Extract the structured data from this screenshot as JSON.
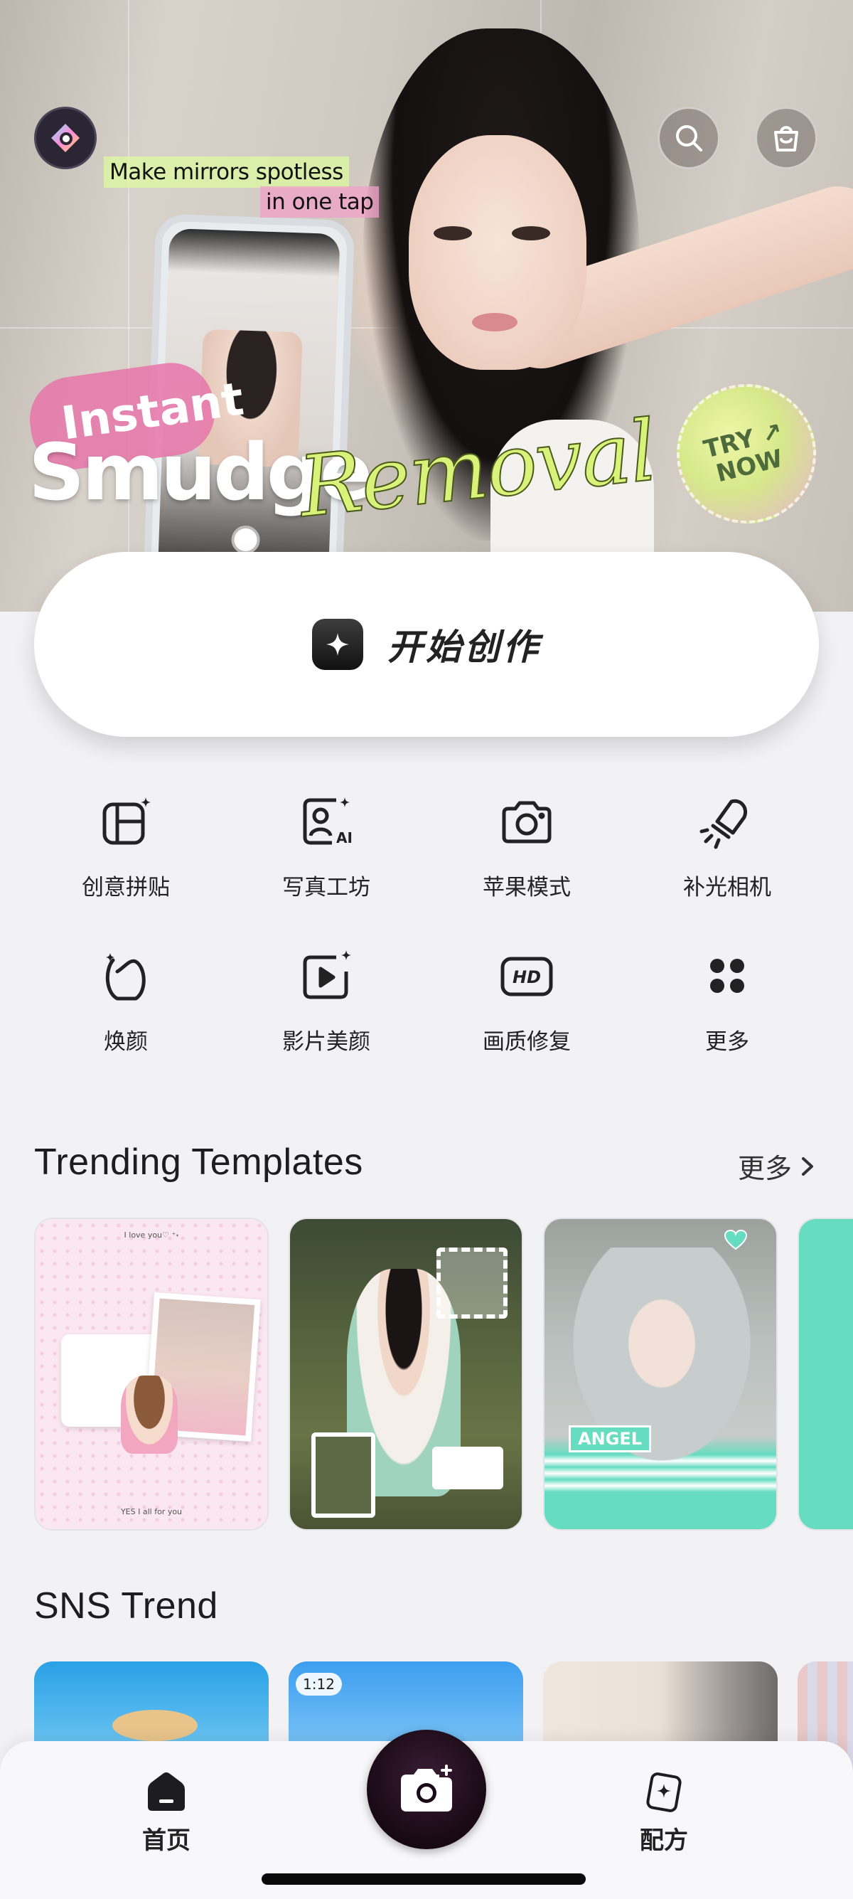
{
  "hero": {
    "promo_line1": "Make mirrors spotless",
    "promo_line2": "in one tap",
    "headline_instant": "Instant",
    "headline_smudge": "Smudge",
    "headline_removal": "Removal",
    "cta_badge_line1": "TRY ↗",
    "cta_badge_line2": "NOW"
  },
  "header": {
    "logo_icon": "app-logo-icon",
    "search_icon": "search-icon",
    "bag_icon": "shopping-bag-icon"
  },
  "cta": {
    "label": "开始创作",
    "icon": "sparkle-icon"
  },
  "features": [
    {
      "label": "创意拼贴",
      "icon": "collage-icon"
    },
    {
      "label": "写真工坊",
      "icon": "ai-portrait-icon"
    },
    {
      "label": "苹果模式",
      "icon": "camera-icon"
    },
    {
      "label": "补光相机",
      "icon": "fill-light-icon"
    },
    {
      "label": "焕颜",
      "icon": "face-retouch-icon"
    },
    {
      "label": "影片美颜",
      "icon": "video-beauty-icon"
    },
    {
      "label": "画质修复",
      "icon": "hd-icon"
    },
    {
      "label": "更多",
      "icon": "more-grid-icon"
    }
  ],
  "trending": {
    "title": "Trending Templates",
    "more": "更多",
    "cards": [
      {
        "top_text": "I love you♡ ⁺˖",
        "bottom_text": "YES I all for you"
      },
      {},
      {
        "sticker_text": "ANGEL"
      },
      {}
    ]
  },
  "sns": {
    "title": "SNS Trend",
    "cards": [
      {},
      {
        "badge": "1:12"
      },
      {},
      {}
    ]
  },
  "bottom_nav": {
    "home": "首页",
    "recipe": "配方"
  },
  "colors": {
    "accent_green": "#d8f27a",
    "accent_pink": "#e876aa",
    "mint": "#66dcc1",
    "camera_button": "#1a0a17"
  }
}
